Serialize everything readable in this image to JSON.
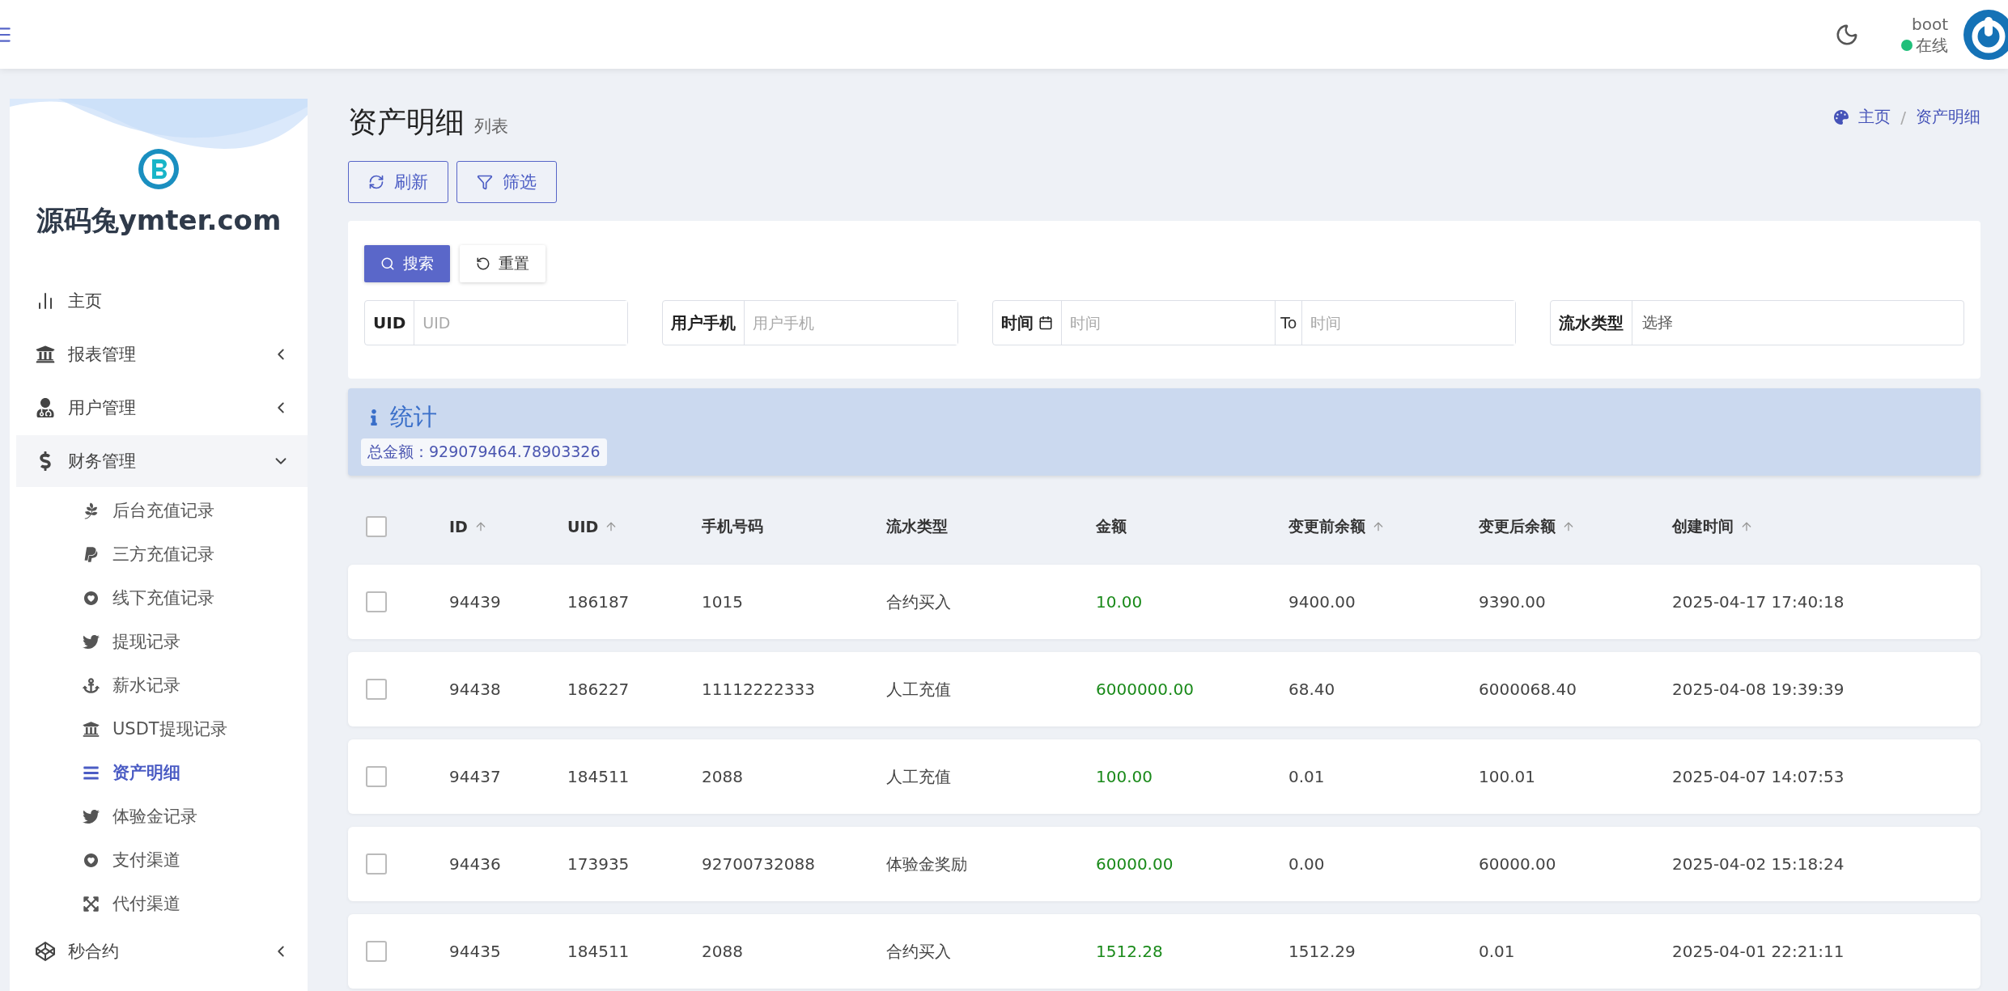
{
  "header": {
    "user": {
      "name": "boot",
      "status": "在线"
    }
  },
  "sidebar": {
    "brand": "源码兔ymter.com",
    "items": [
      {
        "label": "主页"
      },
      {
        "label": "报表管理",
        "expanded": false
      },
      {
        "label": "用户管理",
        "expanded": false
      },
      {
        "label": "财务管理",
        "expanded": true,
        "children": [
          {
            "label": "后台充值记录",
            "selected": false
          },
          {
            "label": "三方充值记录",
            "selected": false
          },
          {
            "label": "线下充值记录",
            "selected": false
          },
          {
            "label": "提现记录",
            "selected": false
          },
          {
            "label": "薪水记录",
            "selected": false
          },
          {
            "label": "USDT提现记录",
            "selected": false
          },
          {
            "label": "资产明细",
            "selected": true
          },
          {
            "label": "体验金记录",
            "selected": false
          },
          {
            "label": "支付渠道",
            "selected": false
          },
          {
            "label": "代付渠道",
            "selected": false
          }
        ]
      },
      {
        "label": "秒合约",
        "expanded": false
      }
    ]
  },
  "page": {
    "title": "资产明细",
    "subtitle": "列表",
    "breadcrumb": [
      "主页",
      "资产明细"
    ],
    "breadcrumb_separator": "/",
    "toolbar": [
      "刷新",
      "筛选"
    ]
  },
  "filter": {
    "buttons": [
      "搜索",
      "重置"
    ],
    "fields": [
      {
        "kind": "text",
        "label": "UID",
        "placeholder": "UID"
      },
      {
        "kind": "text",
        "label": "用户手机",
        "placeholder": "用户手机"
      },
      {
        "kind": "range",
        "label": "时间",
        "placeholder": "时间",
        "separator": "To",
        "placeholder_end": "时间"
      },
      {
        "kind": "select",
        "label": "流水类型",
        "placeholder": "选择"
      }
    ]
  },
  "stats": {
    "title": "统计",
    "label": "总金额：",
    "value": "929079464.78903326"
  },
  "table": {
    "select_all": {
      "checked": false
    },
    "columns": [
      {
        "label": "ID",
        "sortable": true
      },
      {
        "label": "UID",
        "sortable": true
      },
      {
        "label": "手机号码",
        "sortable": false
      },
      {
        "label": "流水类型",
        "sortable": false
      },
      {
        "label": "金额",
        "sortable": false
      },
      {
        "label": "变更前余额",
        "sortable": true
      },
      {
        "label": "变更后余额",
        "sortable": true
      },
      {
        "label": "创建时间",
        "sortable": true
      }
    ],
    "rows": [
      {
        "checked": false,
        "cells": [
          "94439",
          "186187",
          "1015",
          "合约买入",
          "10.00",
          "9400.00",
          "9390.00",
          "2025-04-17 17:40:18"
        ]
      },
      {
        "checked": false,
        "cells": [
          "94438",
          "186227",
          "11112222333",
          "人工充值",
          "6000000.00",
          "68.40",
          "6000068.40",
          "2025-04-08 19:39:39"
        ]
      },
      {
        "checked": false,
        "cells": [
          "94437",
          "184511",
          "2088",
          "人工充值",
          "100.00",
          "0.01",
          "100.01",
          "2025-04-07 14:07:53"
        ]
      },
      {
        "checked": false,
        "cells": [
          "94436",
          "173935",
          "92700732088",
          "体验金奖励",
          "60000.00",
          "0.00",
          "60000.00",
          "2025-04-02 15:18:24"
        ]
      },
      {
        "checked": false,
        "cells": [
          "94435",
          "184511",
          "2088",
          "合约买入",
          "1512.28",
          "1512.29",
          "0.01",
          "2025-04-01 22:21:11"
        ]
      }
    ]
  }
}
